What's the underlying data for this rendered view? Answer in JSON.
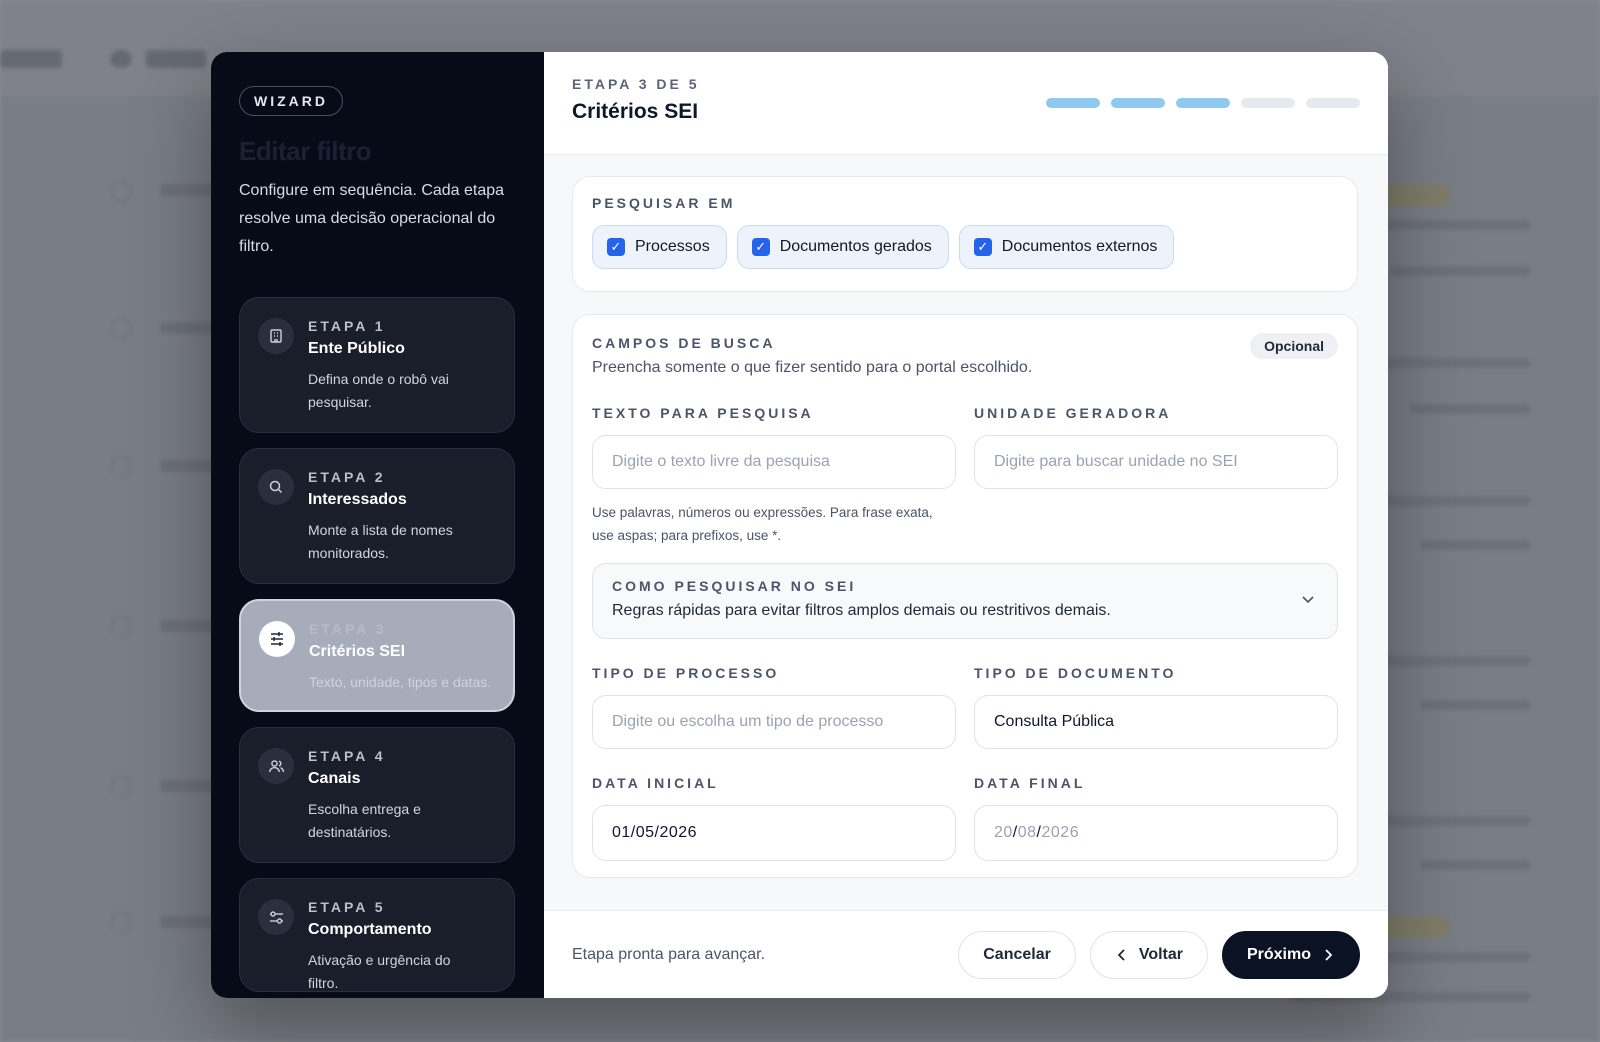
{
  "wizard": {
    "badge": "WIZARD",
    "title": "Editar filtro",
    "description": "Configure em sequência. Cada etapa resolve uma decisão operacional do filtro.",
    "steps": [
      {
        "number": "ETAPA 1",
        "title": "Ente Público",
        "description": "Defina onde o robô vai pesquisar.",
        "icon": "building-icon"
      },
      {
        "number": "ETAPA 2",
        "title": "Interessados",
        "description": "Monte a lista de nomes monitorados.",
        "icon": "search-icon"
      },
      {
        "number": "ETAPA 3",
        "title": "Critérios SEI",
        "description": "Texto, unidade, tipos e datas.",
        "icon": "sliders-icon"
      },
      {
        "number": "ETAPA 4",
        "title": "Canais",
        "description": "Escolha entrega e destinatários.",
        "icon": "users-icon"
      },
      {
        "number": "ETAPA 5",
        "title": "Comportamento",
        "description": "Ativação e urgência do filtro.",
        "icon": "settings-toggle-icon"
      }
    ],
    "active_step": 3
  },
  "header": {
    "step_label": "ETAPA 3 DE 5",
    "title": "Critérios SEI",
    "progress": {
      "completed": 3,
      "total": 5
    }
  },
  "search_in": {
    "label": "PESQUISAR EM",
    "options": [
      {
        "label": "Processos",
        "checked": true
      },
      {
        "label": "Documentos gerados",
        "checked": true
      },
      {
        "label": "Documentos externos",
        "checked": true
      }
    ]
  },
  "search_fields": {
    "label": "CAMPOS DE BUSCA",
    "optional_badge": "Opcional",
    "subtitle": "Preencha somente o que fizer sentido para o portal escolhido.",
    "text": {
      "label": "TEXTO PARA PESQUISA",
      "placeholder": "Digite o texto livre da pesquisa",
      "hint": "Use palavras, números ou expressões. Para frase exata, use aspas; para prefixos, use *."
    },
    "unit": {
      "label": "UNIDADE GERADORA",
      "placeholder": "Digite para buscar unidade no SEI"
    },
    "how_to": {
      "title": "COMO PESQUISAR NO SEI",
      "description": "Regras rápidas para evitar filtros amplos demais ou restritivos demais."
    },
    "process_type": {
      "label": "TIPO DE PROCESSO",
      "placeholder": "Digite ou escolha um tipo de processo"
    },
    "document_type": {
      "label": "TIPO DE DOCUMENTO",
      "value": "Consulta Pública"
    },
    "start_date": {
      "label": "DATA INICIAL",
      "value": "01/05/2026"
    },
    "end_date": {
      "label": "DATA FINAL",
      "day": "20",
      "month": "08",
      "year": "2026",
      "sep": "/"
    }
  },
  "footer": {
    "status": "Etapa pronta para avançar.",
    "cancel": "Cancelar",
    "back": "Voltar",
    "next": "Próximo"
  },
  "colors": {
    "sidebar_bg": "#070b18",
    "accent": "#2563eb",
    "progress_done": "#8fc9f0",
    "primary_button": "#0b1224"
  }
}
